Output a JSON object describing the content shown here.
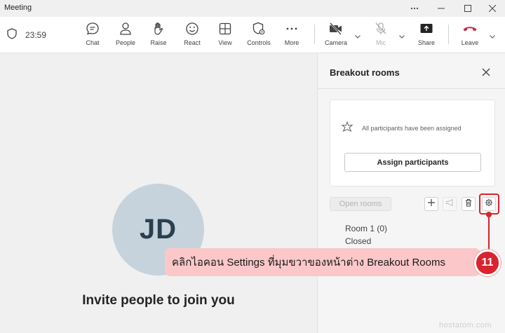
{
  "window": {
    "title": "Meeting"
  },
  "toolbar": {
    "timer": "23:59",
    "buttons": [
      {
        "label": "Chat",
        "icon": "chat-icon"
      },
      {
        "label": "People",
        "icon": "people-icon"
      },
      {
        "label": "Raise",
        "icon": "raise-hand-icon"
      },
      {
        "label": "React",
        "icon": "react-icon"
      },
      {
        "label": "View",
        "icon": "view-icon"
      },
      {
        "label": "Controls",
        "icon": "controls-icon"
      },
      {
        "label": "More",
        "icon": "more-icon"
      },
      {
        "label": "Camera",
        "icon": "camera-off-icon"
      },
      {
        "label": "Mic",
        "icon": "mic-off-icon"
      },
      {
        "label": "Share",
        "icon": "share-icon"
      },
      {
        "label": "Leave",
        "icon": "leave-phone-icon"
      }
    ]
  },
  "stage": {
    "avatar_initials": "JD",
    "invite_text": "Invite people to join you"
  },
  "breakout": {
    "title": "Breakout rooms",
    "assigned_message": "All participants have been assigned",
    "assign_button": "Assign participants",
    "open_rooms_button": "Open rooms",
    "rooms": [
      {
        "name": "Room 1 (0)",
        "status": "Closed"
      }
    ]
  },
  "annotation": {
    "step": "11",
    "text": "คลิกไอคอน Settings ที่มุมขวาของหน้าต่าง Breakout Rooms"
  },
  "watermark": "hostatom.com",
  "colors": {
    "accent_red": "#d9232d",
    "callout_bg": "#fbc7c9",
    "avatar_bg": "#c6d3dc",
    "leave_red": "#c4314b"
  }
}
